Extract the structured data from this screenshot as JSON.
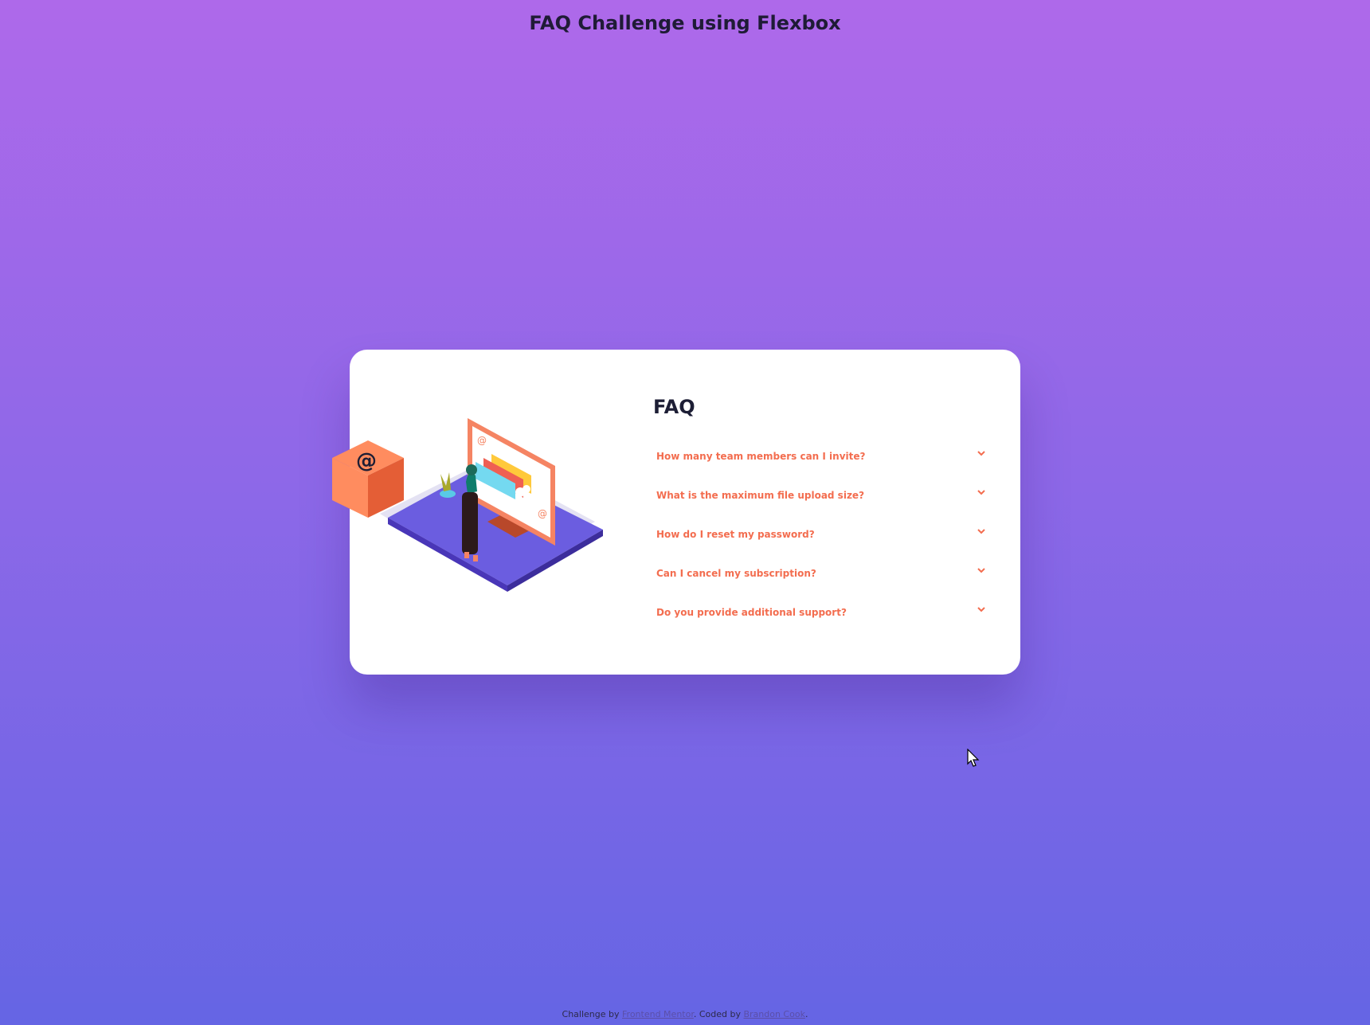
{
  "page": {
    "heading": "FAQ Challenge using Flexbox"
  },
  "card": {
    "title": "FAQ",
    "questions": [
      "How many team members can I invite?",
      "What is the maximum file upload size?",
      "How do I reset my password?",
      "Can I cancel my subscription?",
      "Do you provide additional support?"
    ],
    "chevron_icon": "chevron-down-icon"
  },
  "footer": {
    "prefix": "Challenge by",
    "mentor_link": "Frontend Mentor",
    "middle": ". Coded by",
    "author_link": "Brandon Cook",
    "suffix": "."
  },
  "colors": {
    "accent": "#f36d4f",
    "heading": "#1d1e35",
    "bg_top": "#ae69ea",
    "bg_bottom": "#6565e4"
  }
}
